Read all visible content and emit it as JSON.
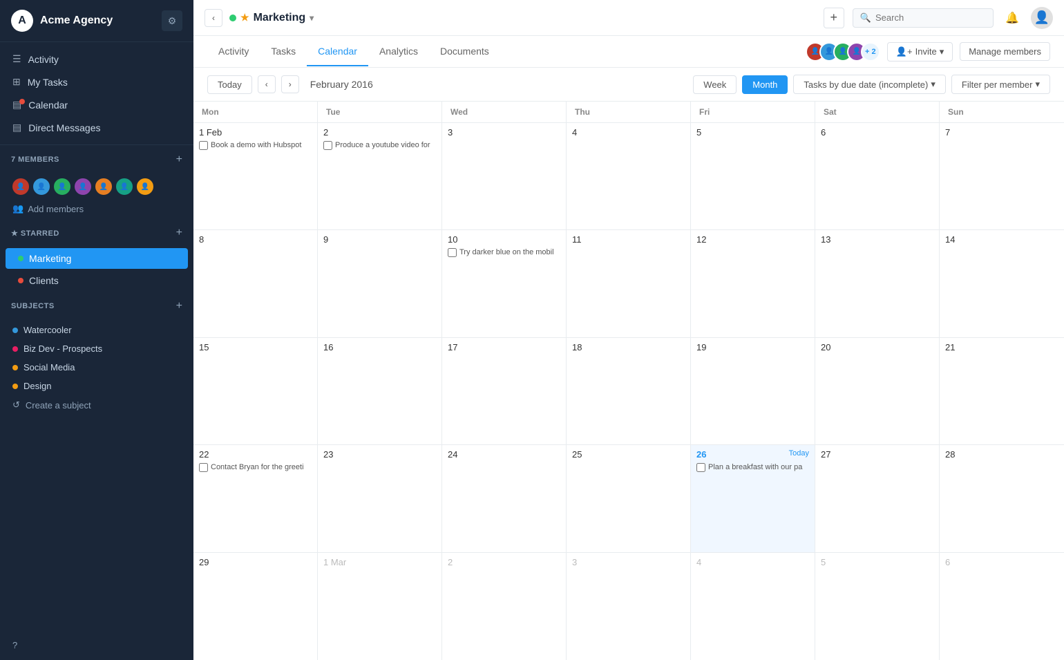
{
  "app": {
    "brand": "Acme Agency",
    "brand_icon": "A"
  },
  "sidebar": {
    "nav_items": [
      {
        "id": "activity",
        "label": "Activity",
        "icon": "▤"
      },
      {
        "id": "my-tasks",
        "label": "My Tasks",
        "icon": "⊞"
      },
      {
        "id": "calendar",
        "label": "Calendar",
        "icon": "▤"
      },
      {
        "id": "direct-messages",
        "label": "Direct Messages",
        "icon": "▤"
      }
    ],
    "members_section": "7 MEMBERS",
    "add_members_label": "Add members",
    "starred_section": "STARRED",
    "starred_items": [
      {
        "id": "marketing",
        "label": "Marketing",
        "color": "#2ecc71",
        "active": true
      },
      {
        "id": "clients",
        "label": "Clients",
        "color": "#e74c3c",
        "active": false
      }
    ],
    "subjects_section": "SUBJECTS",
    "subjects": [
      {
        "id": "watercooler",
        "label": "Watercooler",
        "color": "#3498db"
      },
      {
        "id": "biz-dev",
        "label": "Biz Dev - Prospects",
        "color": "#e91e63"
      },
      {
        "id": "social-media",
        "label": "Social Media",
        "color": "#f39c12"
      },
      {
        "id": "design",
        "label": "Design",
        "color": "#f39c12"
      }
    ],
    "create_subject_label": "Create a subject",
    "help_label": "?"
  },
  "topbar": {
    "project_name": "Marketing",
    "plus_label": "+",
    "search_placeholder": "Search",
    "bell": "🔔"
  },
  "tabs": {
    "items": [
      {
        "id": "activity",
        "label": "Activity"
      },
      {
        "id": "tasks",
        "label": "Tasks"
      },
      {
        "id": "calendar",
        "label": "Calendar"
      },
      {
        "id": "analytics",
        "label": "Analytics"
      },
      {
        "id": "documents",
        "label": "Documents"
      }
    ],
    "active_tab": "calendar",
    "member_count_extra": "+ 2",
    "invite_label": "Invite",
    "manage_label": "Manage members"
  },
  "calendar": {
    "today_label": "Today",
    "month_label": "February 2016",
    "week_label": "Week",
    "month_btn_label": "Month",
    "tasks_filter_label": "Tasks by due date (incomplete)",
    "member_filter_label": "Filter per member",
    "day_headers": [
      "Mon",
      "Tue",
      "Wed",
      "Thu",
      "Fri",
      "Sat",
      "Sun"
    ],
    "weeks": [
      [
        {
          "day": "1 Feb",
          "date": 1,
          "other_month": false,
          "today": false,
          "tasks": [
            "Book a demo with Hubspot"
          ]
        },
        {
          "day": "2",
          "date": 2,
          "other_month": false,
          "today": false,
          "tasks": [
            "Produce a youtube video for"
          ]
        },
        {
          "day": "3",
          "date": 3,
          "other_month": false,
          "today": false,
          "tasks": []
        },
        {
          "day": "4",
          "date": 4,
          "other_month": false,
          "today": false,
          "tasks": []
        },
        {
          "day": "5",
          "date": 5,
          "other_month": false,
          "today": false,
          "tasks": []
        },
        {
          "day": "6",
          "date": 6,
          "other_month": false,
          "today": false,
          "tasks": []
        },
        {
          "day": "7",
          "date": 7,
          "other_month": false,
          "today": false,
          "tasks": []
        }
      ],
      [
        {
          "day": "8",
          "date": 8,
          "other_month": false,
          "today": false,
          "tasks": []
        },
        {
          "day": "9",
          "date": 9,
          "other_month": false,
          "today": false,
          "tasks": []
        },
        {
          "day": "10",
          "date": 10,
          "other_month": false,
          "today": false,
          "tasks": [
            "Try darker blue on the mobil"
          ]
        },
        {
          "day": "11",
          "date": 11,
          "other_month": false,
          "today": false,
          "tasks": []
        },
        {
          "day": "12",
          "date": 12,
          "other_month": false,
          "today": false,
          "tasks": []
        },
        {
          "day": "13",
          "date": 13,
          "other_month": false,
          "today": false,
          "tasks": []
        },
        {
          "day": "14",
          "date": 14,
          "other_month": false,
          "today": false,
          "tasks": []
        }
      ],
      [
        {
          "day": "15",
          "date": 15,
          "other_month": false,
          "today": false,
          "tasks": []
        },
        {
          "day": "16",
          "date": 16,
          "other_month": false,
          "today": false,
          "tasks": []
        },
        {
          "day": "17",
          "date": 17,
          "other_month": false,
          "today": false,
          "tasks": []
        },
        {
          "day": "18",
          "date": 18,
          "other_month": false,
          "today": false,
          "tasks": []
        },
        {
          "day": "19",
          "date": 19,
          "other_month": false,
          "today": false,
          "tasks": []
        },
        {
          "day": "20",
          "date": 20,
          "other_month": false,
          "today": false,
          "tasks": []
        },
        {
          "day": "21",
          "date": 21,
          "other_month": false,
          "today": false,
          "tasks": []
        }
      ],
      [
        {
          "day": "22",
          "date": 22,
          "other_month": false,
          "today": false,
          "tasks": [
            "Contact Bryan for the greeti"
          ]
        },
        {
          "day": "23",
          "date": 23,
          "other_month": false,
          "today": false,
          "tasks": []
        },
        {
          "day": "24",
          "date": 24,
          "other_month": false,
          "today": false,
          "tasks": []
        },
        {
          "day": "25",
          "date": 25,
          "other_month": false,
          "today": false,
          "tasks": []
        },
        {
          "day": "26",
          "date": 26,
          "other_month": false,
          "today": true,
          "tasks": [
            "Plan a breakfast with our pa"
          ]
        },
        {
          "day": "27",
          "date": 27,
          "other_month": false,
          "today": false,
          "tasks": []
        },
        {
          "day": "28",
          "date": 28,
          "other_month": false,
          "today": false,
          "tasks": []
        }
      ],
      [
        {
          "day": "29",
          "date": 29,
          "other_month": false,
          "today": false,
          "tasks": []
        },
        {
          "day": "1 Mar",
          "date": "1M",
          "other_month": true,
          "today": false,
          "tasks": []
        },
        {
          "day": "2",
          "date": "2M",
          "other_month": true,
          "today": false,
          "tasks": []
        },
        {
          "day": "3",
          "date": "3M",
          "other_month": true,
          "today": false,
          "tasks": []
        },
        {
          "day": "4",
          "date": "4M",
          "other_month": true,
          "today": false,
          "tasks": []
        },
        {
          "day": "5",
          "date": "5M",
          "other_month": true,
          "today": false,
          "tasks": []
        },
        {
          "day": "6",
          "date": "6M",
          "other_month": true,
          "today": false,
          "tasks": []
        }
      ]
    ]
  },
  "member_avatars": [
    {
      "bg": "#e67e22"
    },
    {
      "bg": "#3498db"
    },
    {
      "bg": "#2ecc71"
    },
    {
      "bg": "#9b59b6"
    },
    {
      "bg": "#e74c3c"
    },
    {
      "bg": "#1abc9c"
    },
    {
      "bg": "#f39c12"
    }
  ]
}
